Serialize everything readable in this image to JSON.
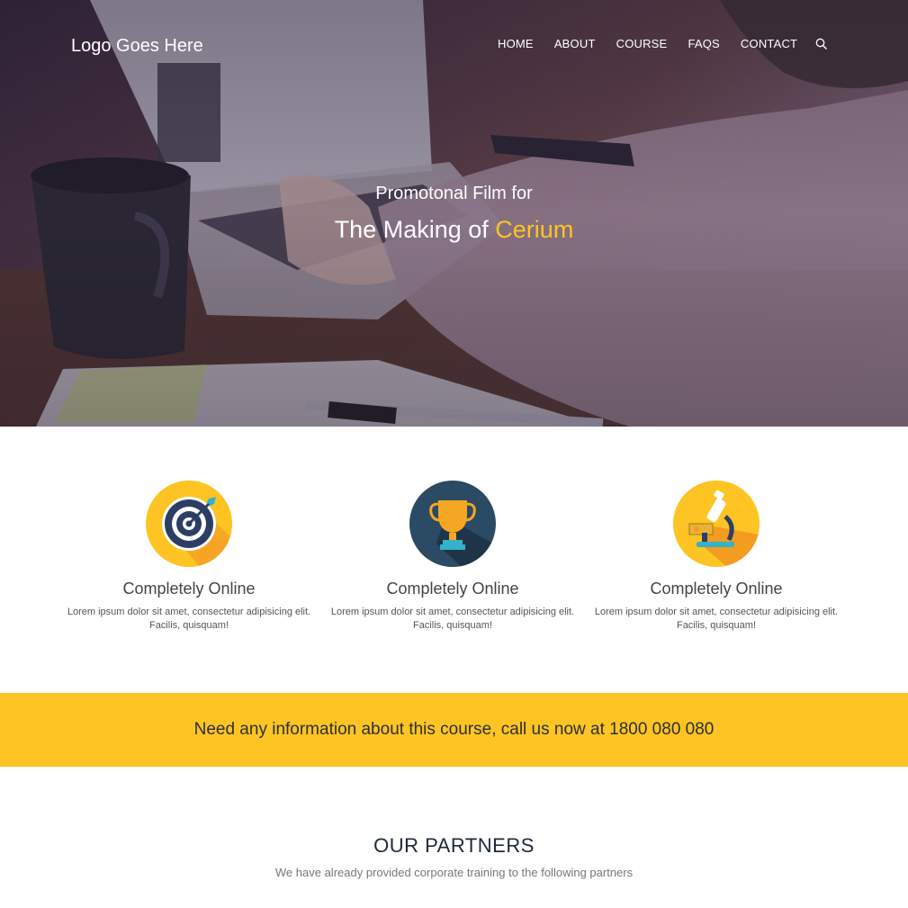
{
  "header": {
    "logo": "Logo Goes Here",
    "nav": [
      "HOME",
      "ABOUT",
      "COURSE",
      "FAQS",
      "CONTACT"
    ],
    "search_icon": "search-icon"
  },
  "hero": {
    "subtitle": "Promotonal Film for",
    "title_prefix": "The Making of",
    "title_accent": "Cerium",
    "accent_color": "#fdc423"
  },
  "features": [
    {
      "icon": "target-icon",
      "title": "Completely Online",
      "text": "Lorem ipsum dolor sit amet, consectetur adipisicing elit. Facilis, quisquam!"
    },
    {
      "icon": "trophy-icon",
      "title": "Completely Online",
      "text": "Lorem ipsum dolor sit amet, consectetur adipisicing elit. Facilis, quisquam!"
    },
    {
      "icon": "microscope-icon",
      "title": "Completely Online",
      "text": "Lorem ipsum dolor sit amet, consectetur adipisicing elit. Facilis, quisquam!"
    }
  ],
  "cta": {
    "text": "Need any information about this course, call us now at 1800 080 080",
    "background": "#fdc423"
  },
  "partners": {
    "title": "OUR PARTNERS",
    "subtitle": "We have already provided corporate training to the following partners"
  }
}
